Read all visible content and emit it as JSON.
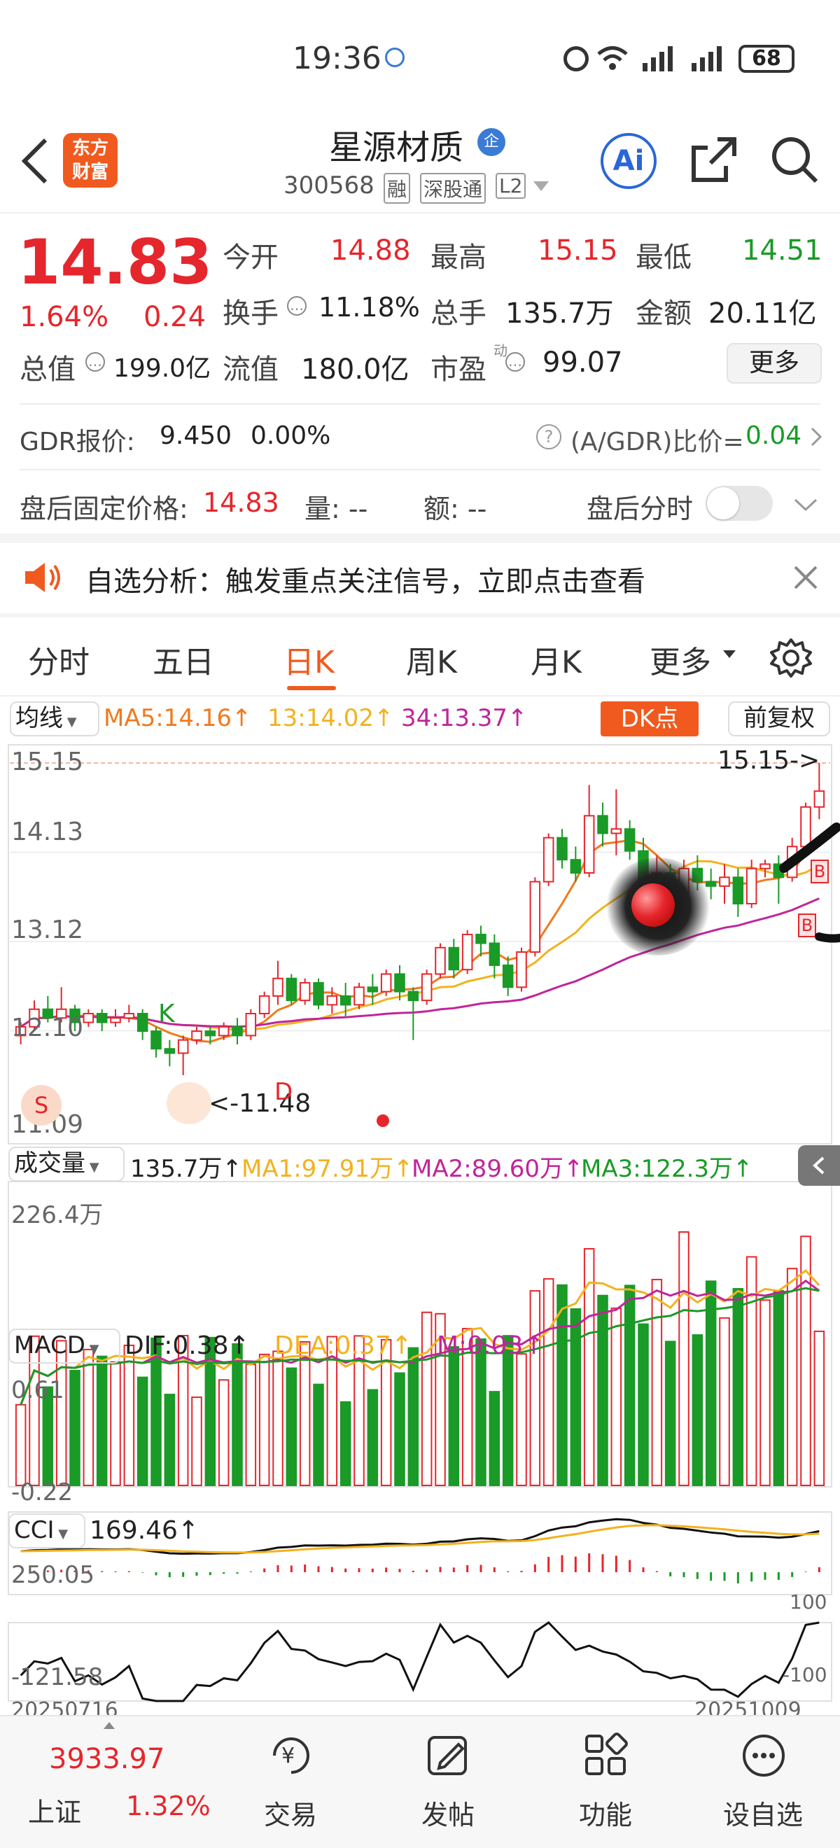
{
  "status": {
    "time": "19:36",
    "battery": "68"
  },
  "header": {
    "title": "星源材质",
    "code": "300568",
    "tags": [
      "融",
      "深股通",
      "L2"
    ],
    "logo_line1": "东方",
    "logo_line2": "财富",
    "ent_badge": "企",
    "ai_label": "Ai"
  },
  "quote": {
    "price": "14.83",
    "change_pct": "1.64%",
    "change": "0.24",
    "open_label": "今开",
    "open": "14.88",
    "high_label": "最高",
    "high": "15.15",
    "low_label": "最低",
    "low": "14.51",
    "turnover_label": "换手",
    "turnover": "11.18%",
    "volume_label": "总手",
    "volume": "135.7万",
    "amount_label": "金额",
    "amount": "20.11亿",
    "mktcap_label": "总值",
    "mktcap": "199.0亿",
    "float_label": "流值",
    "float": "180.0亿",
    "pe_label": "市盈",
    "pe_sup": "动",
    "pe": "99.07",
    "more_button": "更多"
  },
  "gdr": {
    "label": "GDR报价:",
    "price": "9.450",
    "pct": "0.00%",
    "ratio_label": "(A/GDR)比价=",
    "ratio": "0.04"
  },
  "after_hours": {
    "label": "盘后固定价格:",
    "price": "14.83",
    "vol_label": "量: --",
    "amt_label": "额: --",
    "timeshare_label": "盘后分时"
  },
  "notice": {
    "text": "自选分析：触发重点关注信号，立即点击查看"
  },
  "tabs": [
    "分时",
    "五日",
    "日K",
    "周K",
    "月K",
    "更多"
  ],
  "active_tab": "日K",
  "kline": {
    "selector": "均线",
    "ma5": "MA5:14.16↑",
    "ma13": "13:14.02↑",
    "ma34": "34:13.37↑",
    "dk_button": "DK点",
    "adjust_button": "前复权",
    "y_labels": [
      "15.15",
      "14.13",
      "13.12",
      "12.10",
      "11.09"
    ],
    "max_label": "15.15->",
    "min_label": "<-11.48",
    "markers": {
      "k": "K",
      "d": "D",
      "s": "S",
      "b": "B"
    }
  },
  "volume": {
    "selector": "成交量",
    "value": "135.7万↑",
    "ma1": "MA1:97.91万↑",
    "ma2": "MA2:89.60万↑",
    "ma3": "MA3:122.3万↑",
    "y_label": "226.4万"
  },
  "macd": {
    "selector": "MACD",
    "dif": "DIF:0.38↑",
    "dea": "DEA:0.37↑",
    "m": "M:0.03↑",
    "y_top": "0.61",
    "y_bot": "-0.22"
  },
  "cci": {
    "selector": "CCI",
    "value": "169.46↑",
    "y_top": "250.05",
    "y_bot": "-121.58",
    "ref_top": "100",
    "ref_bot": "-100",
    "date_start": "20250716",
    "date_end": "20251009"
  },
  "bottom_nav": {
    "index_value": "3933.97",
    "index_name": "上证",
    "index_pct": "1.32%",
    "trade": "交易",
    "post": "发帖",
    "func": "功能",
    "watch": "设自选"
  },
  "colors": {
    "up": "#e5262c",
    "down": "#1a9a27",
    "accent": "#f05a1e",
    "ma5": "#f07a1e",
    "ma13": "#f2b21e",
    "ma34": "#c0259a"
  },
  "chart_data": {
    "type": "candlestick",
    "ylim": [
      11.09,
      15.15
    ],
    "candles": [
      [
        12.05,
        12.15,
        11.95,
        12.2
      ],
      [
        12.15,
        12.35,
        12.1,
        12.45
      ],
      [
        12.35,
        12.25,
        12.2,
        12.5
      ],
      [
        12.25,
        12.35,
        12.2,
        12.6
      ],
      [
        12.35,
        12.2,
        12.1,
        12.4
      ],
      [
        12.2,
        12.3,
        12.15,
        12.35
      ],
      [
        12.3,
        12.2,
        12.1,
        12.35
      ],
      [
        12.2,
        12.25,
        12.15,
        12.35
      ],
      [
        12.25,
        12.3,
        12.2,
        12.4
      ],
      [
        12.3,
        12.1,
        12.0,
        12.35
      ],
      [
        12.1,
        11.9,
        11.8,
        12.15
      ],
      [
        11.9,
        11.85,
        11.7,
        12.0
      ],
      [
        11.85,
        12.0,
        11.6,
        12.05
      ],
      [
        12.0,
        12.1,
        11.95,
        12.15
      ],
      [
        12.1,
        12.05,
        11.95,
        12.15
      ],
      [
        12.05,
        12.15,
        12.0,
        12.2
      ],
      [
        12.15,
        12.05,
        11.95,
        12.25
      ],
      [
        12.05,
        12.3,
        12.0,
        12.35
      ],
      [
        12.3,
        12.5,
        12.25,
        12.55
      ],
      [
        12.5,
        12.7,
        12.4,
        12.9
      ],
      [
        12.7,
        12.45,
        12.4,
        12.75
      ],
      [
        12.45,
        12.65,
        12.4,
        12.7
      ],
      [
        12.65,
        12.4,
        12.35,
        12.7
      ],
      [
        12.4,
        12.5,
        12.3,
        12.6
      ],
      [
        12.5,
        12.4,
        12.25,
        12.65
      ],
      [
        12.4,
        12.6,
        12.35,
        12.65
      ],
      [
        12.6,
        12.55,
        12.4,
        12.75
      ],
      [
        12.55,
        12.75,
        12.5,
        12.8
      ],
      [
        12.75,
        12.55,
        12.45,
        12.85
      ],
      [
        12.55,
        12.45,
        12.0,
        12.6
      ],
      [
        12.45,
        12.75,
        12.4,
        12.8
      ],
      [
        12.75,
        13.05,
        12.7,
        13.1
      ],
      [
        13.05,
        12.8,
        12.7,
        13.15
      ],
      [
        12.8,
        13.2,
        12.75,
        13.25
      ],
      [
        13.2,
        13.1,
        12.95,
        13.3
      ],
      [
        13.1,
        12.85,
        12.7,
        13.2
      ],
      [
        12.85,
        12.6,
        12.5,
        12.95
      ],
      [
        12.6,
        13.0,
        12.55,
        13.05
      ],
      [
        13.0,
        13.8,
        12.95,
        13.85
      ],
      [
        13.8,
        14.3,
        13.75,
        14.35
      ],
      [
        14.3,
        14.05,
        13.95,
        14.4
      ],
      [
        14.05,
        13.9,
        13.8,
        14.2
      ],
      [
        13.9,
        14.55,
        13.85,
        14.9
      ],
      [
        14.55,
        14.35,
        14.2,
        14.7
      ],
      [
        14.35,
        14.4,
        14.1,
        14.85
      ],
      [
        14.4,
        14.15,
        14.05,
        14.5
      ],
      [
        14.15,
        13.7,
        13.6,
        14.3
      ],
      [
        13.7,
        13.9,
        13.55,
        14.1
      ],
      [
        13.9,
        13.6,
        13.5,
        14.0
      ],
      [
        13.6,
        13.95,
        13.55,
        14.05
      ],
      [
        13.95,
        13.8,
        13.7,
        14.1
      ],
      [
        13.8,
        13.75,
        13.6,
        13.95
      ],
      [
        13.75,
        13.85,
        13.55,
        14.0
      ],
      [
        13.85,
        13.55,
        13.4,
        13.95
      ],
      [
        13.55,
        13.95,
        13.5,
        14.05
      ],
      [
        13.95,
        14.0,
        13.85,
        14.05
      ],
      [
        14.0,
        13.85,
        13.55,
        14.1
      ],
      [
        13.85,
        14.2,
        13.8,
        14.3
      ],
      [
        14.2,
        14.65,
        14.15,
        14.7
      ],
      [
        14.65,
        14.83,
        14.51,
        15.15
      ]
    ]
  }
}
